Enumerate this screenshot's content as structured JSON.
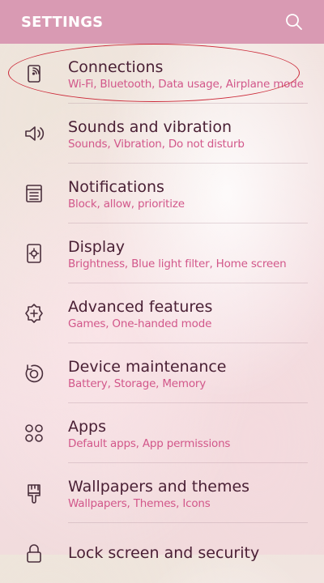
{
  "header": {
    "title": "SETTINGS",
    "search_icon": "search-icon"
  },
  "colors": {
    "header_bg": "#d99ab3",
    "title_text": "#4a2035",
    "subtitle_text": "#d2578a",
    "highlight_ring": "#cc2b3a"
  },
  "settings": {
    "items": [
      {
        "title": "Connections",
        "subtitle": "Wi-Fi, Bluetooth, Data usage, Airplane mode",
        "icon": "connections-icon"
      },
      {
        "title": "Sounds and vibration",
        "subtitle": "Sounds, Vibration, Do not disturb",
        "icon": "speaker-icon"
      },
      {
        "title": "Notifications",
        "subtitle": "Block, allow, prioritize",
        "icon": "notifications-icon"
      },
      {
        "title": "Display",
        "subtitle": "Brightness, Blue light filter, Home screen",
        "icon": "display-icon"
      },
      {
        "title": "Advanced features",
        "subtitle": "Games, One-handed mode",
        "icon": "advanced-features-icon"
      },
      {
        "title": "Device maintenance",
        "subtitle": "Battery, Storage, Memory",
        "icon": "device-maintenance-icon"
      },
      {
        "title": "Apps",
        "subtitle": "Default apps, App permissions",
        "icon": "apps-icon"
      },
      {
        "title": "Wallpapers and themes",
        "subtitle": "Wallpapers, Themes, Icons",
        "icon": "paintbrush-icon"
      },
      {
        "title": "Lock screen and security",
        "subtitle": "",
        "icon": "lock-icon"
      }
    ]
  }
}
